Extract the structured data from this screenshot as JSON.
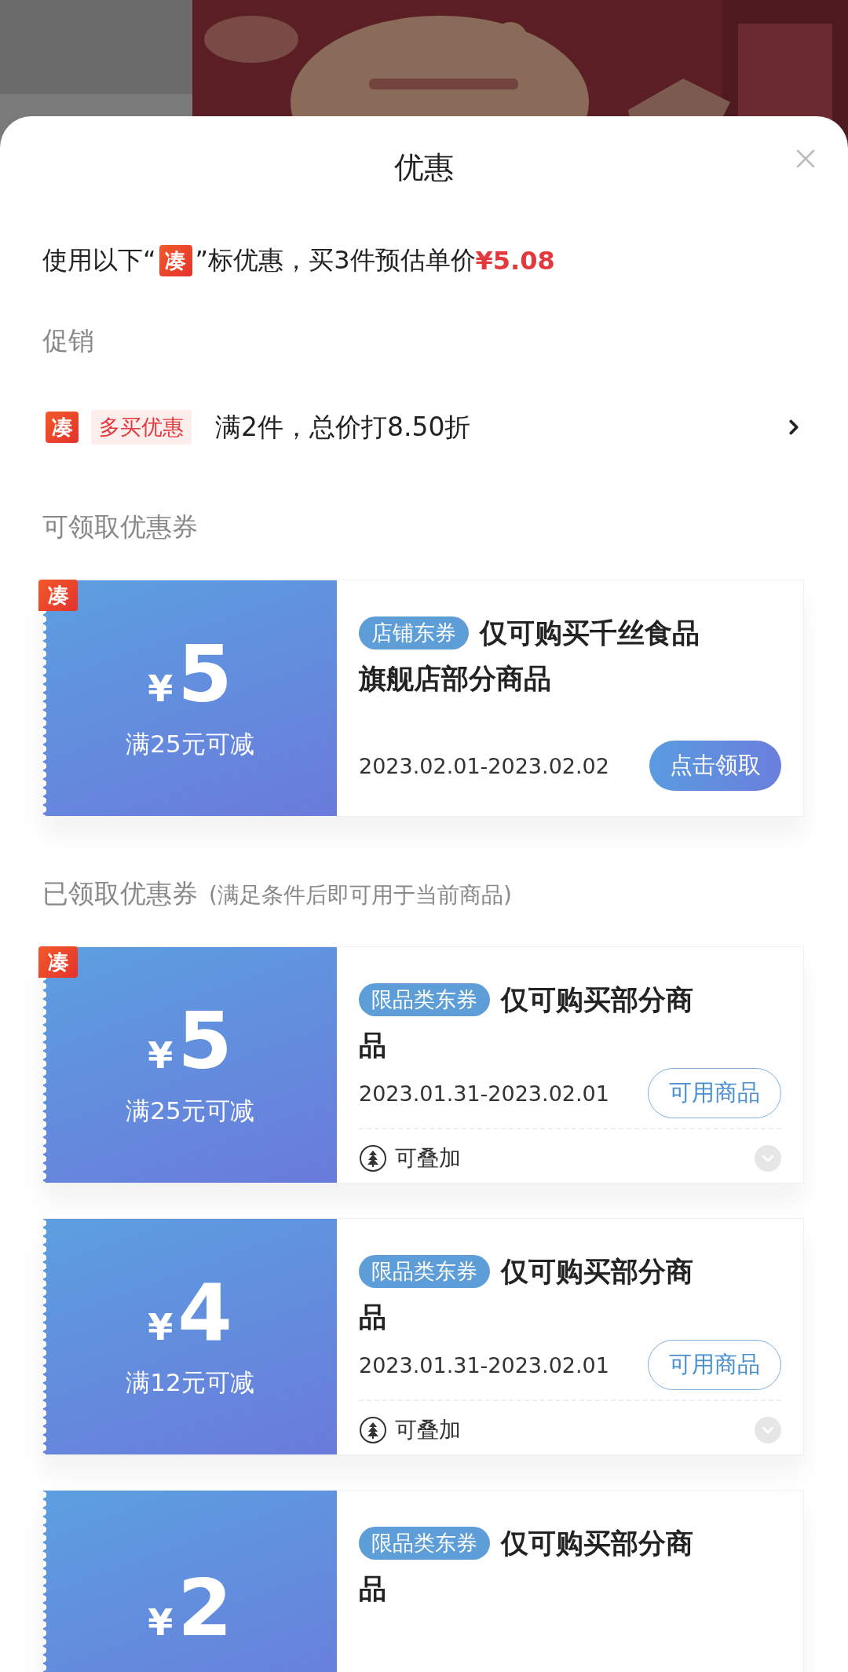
{
  "sheet": {
    "title": "优惠"
  },
  "summary": {
    "prefix": "使用以下“",
    "badge": "凑",
    "suffix": "”标优惠，买3件预估单价",
    "price": "¥5.08"
  },
  "promotion": {
    "heading": "促销",
    "badge": "凑",
    "tag": "多买优惠",
    "text": "满2件，总价打8.50折"
  },
  "available": {
    "heading": "可领取优惠券",
    "coupons": [
      {
        "badge": "凑",
        "currency": "¥",
        "amount": "5",
        "condition": "满25元可减",
        "tag": "店铺东券",
        "title_lines": [
          "仅可购买千丝食品",
          "旗舰店部分商品"
        ],
        "date": "2023.02.01-2023.02.02",
        "action": {
          "label": "点击领取",
          "kind": "filled"
        }
      }
    ]
  },
  "claimed": {
    "heading": "已领取优惠券",
    "note": "(满足条件后即可用于当前商品)",
    "coupons": [
      {
        "badge": "凑",
        "currency": "¥",
        "amount": "5",
        "condition": "满25元可减",
        "tag": "限品类东券",
        "title_lines": [
          "仅可购买部分商",
          "品"
        ],
        "date": "2023.01.31-2023.02.01",
        "action": {
          "label": "可用商品",
          "kind": "outline"
        },
        "stack": "可叠加"
      },
      {
        "currency": "¥",
        "amount": "4",
        "condition": "满12元可减",
        "tag": "限品类东券",
        "title_lines": [
          "仅可购买部分商",
          "品"
        ],
        "date": "2023.01.31-2023.02.01",
        "action": {
          "label": "可用商品",
          "kind": "outline"
        },
        "stack": "可叠加"
      },
      {
        "currency": "¥",
        "amount": "2",
        "tag": "限品类东券",
        "title_lines": [
          "仅可购买部分商",
          "品"
        ]
      }
    ]
  }
}
